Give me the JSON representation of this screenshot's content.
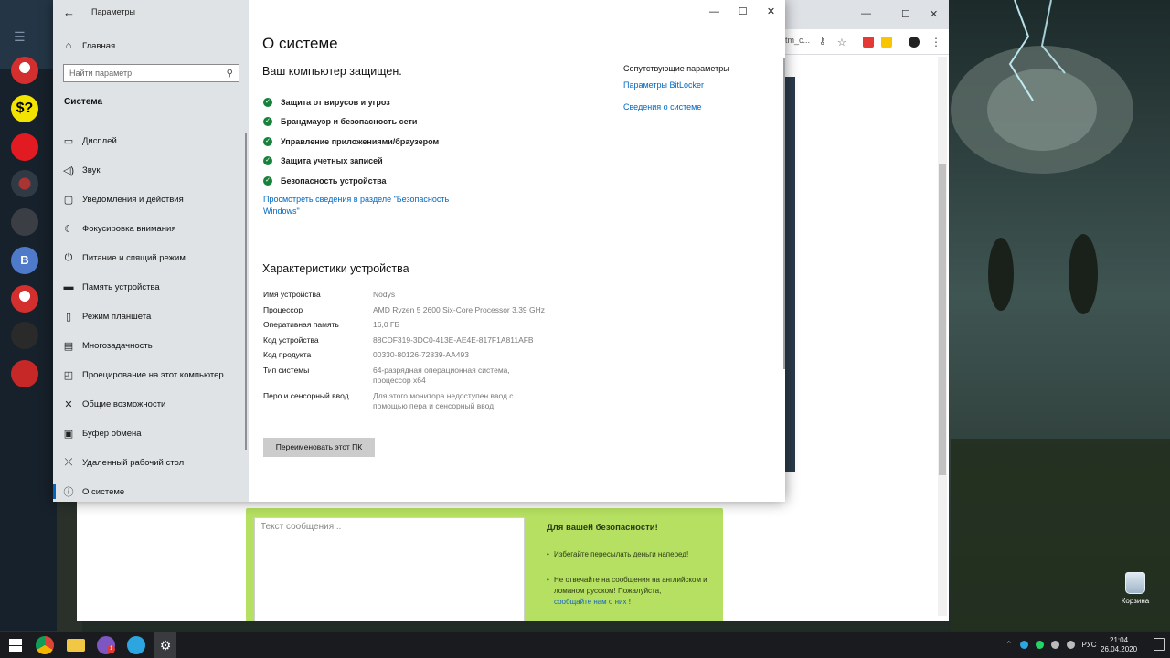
{
  "settings": {
    "window_title": "Параметры",
    "home_label": "Главная",
    "search_placeholder": "Найти параметр",
    "section_title": "Система",
    "nav_items": [
      {
        "label": "Дисплей",
        "icon": "display-icon"
      },
      {
        "label": "Звук",
        "icon": "speaker-icon"
      },
      {
        "label": "Уведомления и действия",
        "icon": "notification-icon"
      },
      {
        "label": "Фокусировка внимания",
        "icon": "moon-icon"
      },
      {
        "label": "Питание и спящий режим",
        "icon": "power-icon"
      },
      {
        "label": "Память устройства",
        "icon": "storage-icon"
      },
      {
        "label": "Режим планшета",
        "icon": "tablet-icon"
      },
      {
        "label": "Многозадачность",
        "icon": "multitask-icon"
      },
      {
        "label": "Проецирование на этот компьютер",
        "icon": "projector-icon"
      },
      {
        "label": "Общие возможности",
        "icon": "shared-icon"
      },
      {
        "label": "Буфер обмена",
        "icon": "clipboard-icon"
      },
      {
        "label": "Удаленный рабочий стол",
        "icon": "remote-desktop-icon"
      },
      {
        "label": "О системе",
        "icon": "info-icon",
        "active": true
      }
    ],
    "page_title": "О системе",
    "protection_heading": "Ваш компьютер защищен.",
    "protection_items": [
      "Защита от вирусов и угроз",
      "Брандмауэр и безопасность сети",
      "Управление приложениями/браузером",
      "Защита учетных записей",
      "Безопасность устройства"
    ],
    "security_link": "Просмотреть сведения в разделе \"Безопасность Windows\"",
    "related_title": "Сопутствующие параметры",
    "related_links": [
      "Параметры BitLocker",
      "Сведения о системе"
    ],
    "device_heading": "Характеристики устройства",
    "specs": [
      {
        "label": "Имя устройства",
        "value": "Nodys"
      },
      {
        "label": "Процессор",
        "value": "AMD Ryzen 5 2600 Six-Core Processor 3.39 GHz"
      },
      {
        "label": "Оперативная память",
        "value": "16,0 ГБ"
      },
      {
        "label": "Код устройства",
        "value": "88CDF319-3DC0-413E-AE4E-817F1A811AFB"
      },
      {
        "label": "Код продукта",
        "value": "00330-80126-72839-AA493"
      },
      {
        "label": "Тип системы",
        "value": "64-разрядная операционная система, процессор x64"
      },
      {
        "label": "Перо и сенсорный ввод",
        "value": "Для этого монитора недоступен ввод с помощью пера и сенсорный ввод"
      }
    ],
    "rename_button": "Переименовать этот ПК",
    "window_controls": {
      "minimize": "—",
      "maximize": "☐",
      "close": "✕"
    }
  },
  "messenger": {
    "avatar_letter_b": "B",
    "avatar_label_s": "$?"
  },
  "browser": {
    "url_tail": "tm_c...",
    "compose_placeholder": "Текст сообщения...",
    "safety_title": "Для вашей безопасности!",
    "safety_items": [
      "Избегайте пересылать деньги наперед!",
      "Не отвечайте на сообщения на английском и ломаном русском! Пожалуйста,"
    ],
    "safety_link": "сообщайте нам о них",
    "safety_link_suffix": " !"
  },
  "desktop": {
    "recycle_bin_label": "Корзина"
  },
  "taskbar": {
    "language": "РУС",
    "time": "21:04",
    "date": "26.04.2020",
    "viber_badge": "1"
  },
  "colors": {
    "accent": "#0067c0",
    "check_green": "#17813b",
    "compose_green": "#b5e061"
  }
}
